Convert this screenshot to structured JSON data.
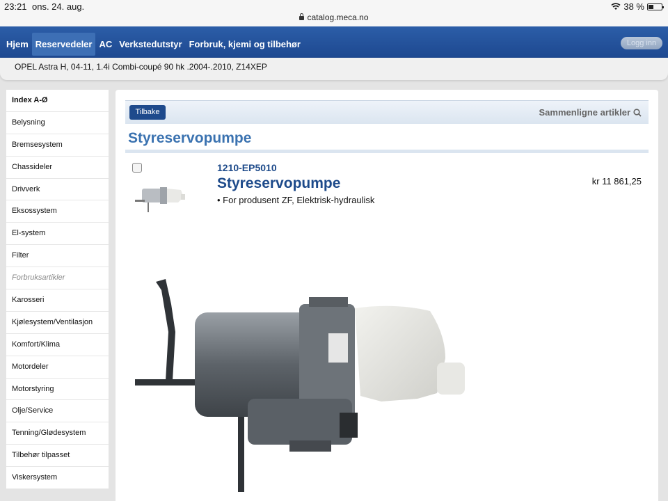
{
  "status": {
    "time": "23:21",
    "date": "ons. 24. aug.",
    "battery": "38 %",
    "url": "catalog.meca.no"
  },
  "nav": {
    "items": [
      {
        "label": "Hjem",
        "active": false
      },
      {
        "label": "Reservedeler",
        "active": true
      },
      {
        "label": "AC",
        "active": false
      },
      {
        "label": "Verkstedutstyr",
        "active": false
      },
      {
        "label": "Forbruk, kjemi og tilbehør",
        "active": false
      }
    ],
    "login_label": "Logg inn"
  },
  "vehicle": "OPEL Astra H, 04-11, 1.4i Combi-coupé 90 hk .2004-.2010, Z14XEP",
  "sidebar": {
    "header": "Index A-Ø",
    "items": [
      {
        "label": "Belysning"
      },
      {
        "label": "Bremsesystem"
      },
      {
        "label": "Chassideler"
      },
      {
        "label": "Drivverk"
      },
      {
        "label": "Eksossystem"
      },
      {
        "label": "El-system"
      },
      {
        "label": "Filter"
      },
      {
        "label": "Forbruksartikler",
        "muted": true
      },
      {
        "label": "Karosseri"
      },
      {
        "label": "Kjølesystem/Ventilasjon"
      },
      {
        "label": "Komfort/Klima"
      },
      {
        "label": "Motordeler"
      },
      {
        "label": "Motorstyring"
      },
      {
        "label": "Olje/Service"
      },
      {
        "label": "Tenning/Glødesystem"
      },
      {
        "label": "Tilbehør tilpasset"
      },
      {
        "label": "Viskersystem"
      }
    ]
  },
  "main": {
    "back_label": "Tilbake",
    "compare_label": "Sammenligne artikler",
    "page_title": "Styreservopumpe",
    "article": {
      "number": "1210-EP5010",
      "name": "Styreservopumpe",
      "description": "• For produsent ZF, Elektrisk-hydraulisk",
      "price": "kr 11 861,25"
    }
  },
  "icons": {
    "wifi": "wifi-icon",
    "battery": "battery-icon",
    "lock": "lock-icon",
    "search": "search-icon"
  }
}
